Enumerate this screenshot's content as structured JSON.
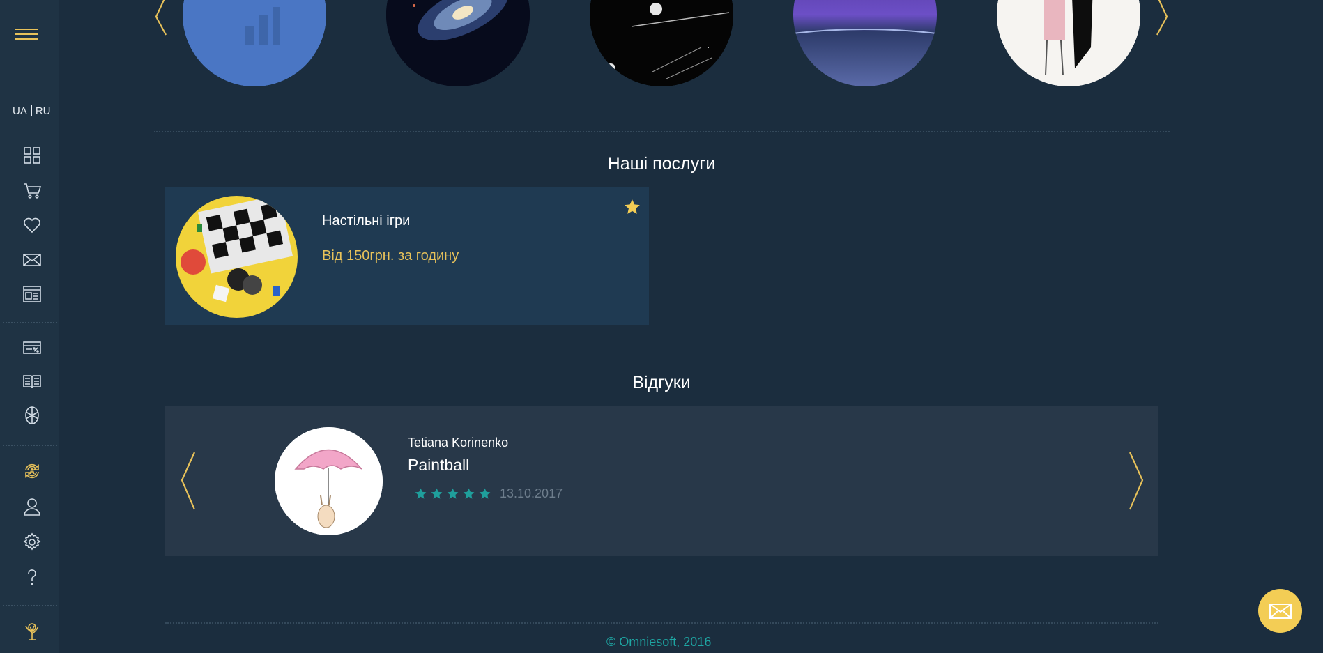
{
  "sidebar": {
    "lang_ua": "UA",
    "lang_ru": "RU",
    "icons": [
      "menu-icon",
      "catalog-icon",
      "cart-icon",
      "favorites-icon",
      "messages-icon",
      "news-icon",
      "discount-card-icon",
      "book-icon",
      "ball-icon",
      "currency-exchange-icon",
      "user-icon",
      "settings-icon",
      "help-icon",
      "tree-logo-icon"
    ]
  },
  "services": {
    "title": "Наші послуги",
    "items": [
      {
        "name": "Настільні ігри",
        "price": "Від 150грн. за годину"
      }
    ]
  },
  "reviews": {
    "title": "Відгуки",
    "items": [
      {
        "author": "Tetiana Korinenko",
        "service": "Paintball",
        "rating": 5,
        "date": "13.10.2017"
      }
    ]
  },
  "footer": {
    "copyright": "© Omniesoft, 2016"
  },
  "colors": {
    "accent": "#e8c25a",
    "teal": "#1f9f9c",
    "background": "#1b2d3e"
  }
}
